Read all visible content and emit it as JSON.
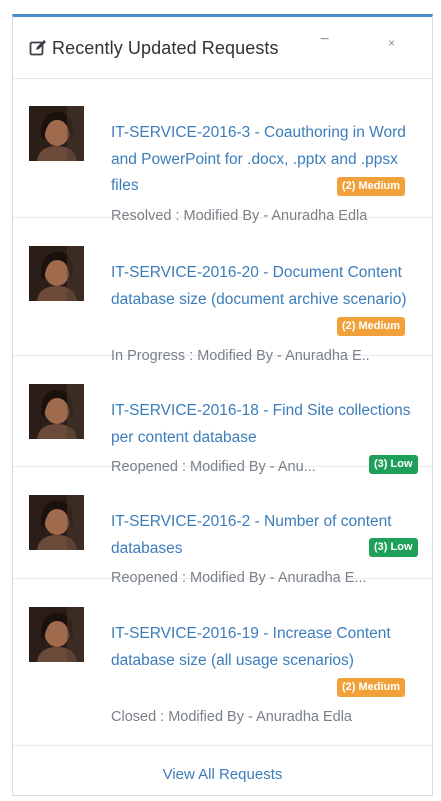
{
  "panel": {
    "title": "Recently Updated Requests",
    "minimize_glyph": "−",
    "close_glyph": "×",
    "title_icon": "edit-icon",
    "accent_color": "#4a8bc8"
  },
  "requests": [
    {
      "title": "IT-SERVICE-2016-3 - Coauthoring in Word and PowerPoint for .docx, .pptx and .ppsx files",
      "priority": "(2) Medium",
      "priority_level": "medium",
      "status_line": "Resolved : Modified By - Anuradha Edla"
    },
    {
      "title": "IT-SERVICE-2016-20 - Document Content database size (document archive scenario)",
      "priority": "(2) Medium",
      "priority_level": "medium",
      "status_line": "In Progress : Modified By - Anuradha E.."
    },
    {
      "title": "IT-SERVICE-2016-18 - Find Site collections per content database",
      "priority": "(3) Low",
      "priority_level": "low",
      "status_line": "Reopened : Modified By - Anu..."
    },
    {
      "title": "IT-SERVICE-2016-2 - Number of content databases",
      "priority": "(3) Low",
      "priority_level": "low",
      "status_line": "Reopened : Modified By - Anuradha E..."
    },
    {
      "title": "IT-SERVICE-2016-19 - Increase Content database size (all usage scenarios)",
      "priority": "(2) Medium",
      "priority_level": "medium",
      "status_line": "Closed : Modified By - Anuradha Edla"
    }
  ],
  "colors": {
    "link": "#3b7dbb",
    "medium_badge": "#f0a13a",
    "low_badge": "#1ea05a",
    "muted_text": "#7a8087"
  },
  "footer": {
    "link_label": "View All Requests"
  }
}
